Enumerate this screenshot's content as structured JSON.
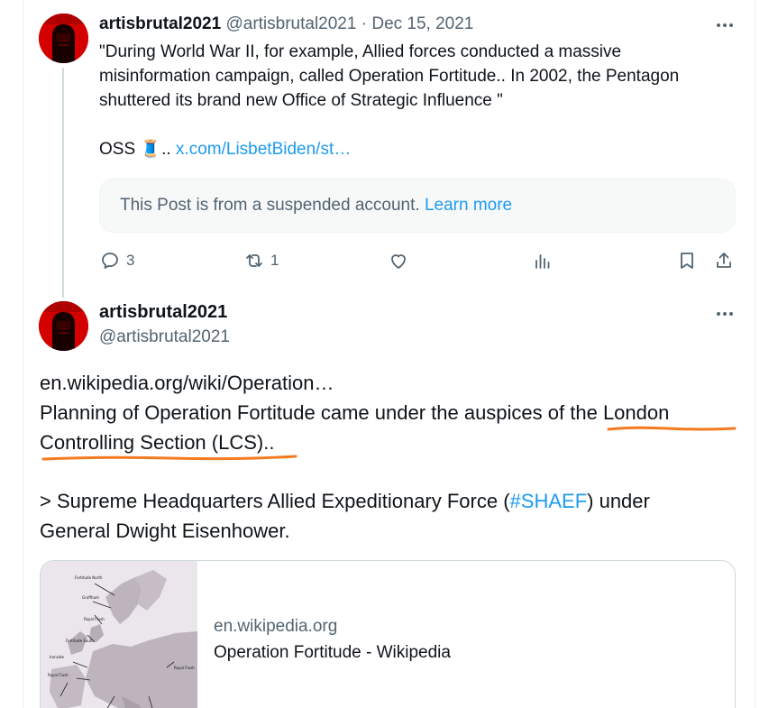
{
  "post1": {
    "display_name": "artisbrutal2021",
    "handle": "@artisbrutal2021",
    "separator": "·",
    "date": "Dec 15, 2021",
    "text": "\"During World War II, for example, Allied forces conducted a massive misinformation campaign, called Operation Fortitude.. In 2002, the Pentagon shuttered its brand new Office of Strategic Influence \"",
    "oss_prefix": "OSS",
    "oss_emoji": "🧵",
    "oss_dots": "..",
    "link_text": "x.com/LisbetBiden/st…",
    "quote_notice": "This Post is from a suspended account.",
    "quote_link": "Learn more",
    "actions": {
      "reply_count": "3",
      "repost_count": "1",
      "like_count": "",
      "icons": [
        "reply-icon",
        "repost-icon",
        "like-icon",
        "views-icon",
        "bookmark-icon",
        "share-icon"
      ]
    }
  },
  "post2": {
    "display_name": "artisbrutal2021",
    "handle": "@artisbrutal2021",
    "link_text": "en.wikipedia.org/wiki/Operation…",
    "line1_a": "Planning of Operation Fortitude came under the auspices o",
    "line1_b": "f the London",
    "line2": "Controlling Section (LCS)..",
    "line3_a": "> Supreme Headquarters Allied Expeditionary Force (",
    "hashtag": "#SHAEF",
    "line3_b": ") under",
    "line4": "General Dwight Eisenhower.",
    "card": {
      "domain": "en.wikipedia.org",
      "title": "Operation Fortitude - Wikipedia",
      "map_labels": [
        "Fortitude North",
        "Graffham",
        "Royal Flush",
        "Fortitude South",
        "Ironside",
        "Royal Flush",
        "Royal Flush"
      ]
    }
  },
  "colors": {
    "text": "#0f1419",
    "muted": "#536471",
    "link": "#1d9bf0",
    "annotation": "#f47a20",
    "avatar_red": "#e00000"
  }
}
